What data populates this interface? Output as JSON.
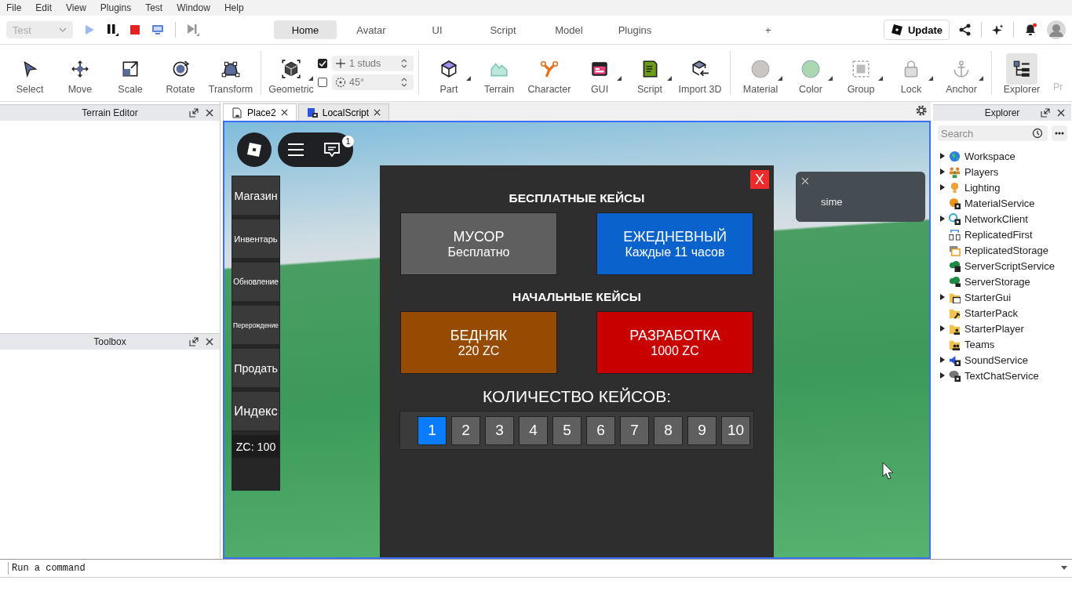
{
  "menu_bar": [
    "File",
    "Edit",
    "View",
    "Plugins",
    "Test",
    "Window",
    "Help"
  ],
  "mode_dropdown": {
    "value": "Test",
    "disabled": true
  },
  "ribbon_tabs": [
    {
      "label": "Home",
      "selected": true
    },
    {
      "label": "Avatar",
      "selected": false
    },
    {
      "label": "UI",
      "selected": false
    },
    {
      "label": "Script",
      "selected": false
    },
    {
      "label": "Model",
      "selected": false
    },
    {
      "label": "Plugins",
      "selected": false
    }
  ],
  "add_tab": "+",
  "update_button": "Update",
  "notification_dot": true,
  "tool_groups": [
    [
      {
        "label": "Select",
        "has_menu": false,
        "selected": false
      },
      {
        "label": "Move",
        "has_menu": false,
        "selected": false
      },
      {
        "label": "Scale",
        "has_menu": false,
        "selected": false
      },
      {
        "label": "Rotate",
        "has_menu": false,
        "selected": false
      },
      {
        "label": "Transform",
        "has_menu": false,
        "selected": false
      }
    ],
    [
      {
        "label": "Geometric",
        "has_menu": true,
        "selected": false
      }
    ],
    [
      {
        "label": "Part",
        "has_menu": true,
        "selected": false
      },
      {
        "label": "Terrain",
        "has_menu": false,
        "selected": false
      },
      {
        "label": "Character",
        "has_menu": false,
        "selected": false
      },
      {
        "label": "GUI",
        "has_menu": true,
        "selected": false
      },
      {
        "label": "Script",
        "has_menu": true,
        "selected": false
      },
      {
        "label": "Import 3D",
        "has_menu": false,
        "selected": false
      }
    ],
    [
      {
        "label": "Material",
        "has_menu": true,
        "selected": false
      },
      {
        "label": "Color",
        "has_menu": true,
        "selected": false
      },
      {
        "label": "Group",
        "has_menu": true,
        "selected": false
      },
      {
        "label": "Lock",
        "has_menu": true,
        "selected": false
      },
      {
        "label": "Anchor",
        "has_menu": true,
        "selected": false
      }
    ],
    [
      {
        "label": "Explorer",
        "has_menu": false,
        "selected": true
      }
    ]
  ],
  "cut_tool_label": "Pr",
  "snap": [
    {
      "checked": true,
      "value": "1 studs"
    },
    {
      "checked": false,
      "value": "45°"
    }
  ],
  "left_panels": [
    {
      "title": "Terrain Editor"
    },
    {
      "title": "Toolbox"
    }
  ],
  "document_tabs": [
    {
      "label": "Place2",
      "selected": true
    },
    {
      "label": "LocalScript",
      "selected": false
    }
  ],
  "game": {
    "chat_badge": "1",
    "side_menu": [
      "Магазин",
      "Инвентарь",
      "Обновление",
      "Перерождение",
      "Продать",
      "Индекс"
    ],
    "currency": "ZC: 100",
    "notification": {
      "text": "sime"
    },
    "panel": {
      "close": "X",
      "sections": [
        {
          "title": "БЕСПЛАТНЫЕ КЕЙСЫ",
          "cases": [
            {
              "title": "МУСОР",
              "subtitle": "Бесплатно",
              "color": "#5f5f5f"
            },
            {
              "title": "ЕЖЕДНЕВНЫЙ",
              "subtitle": "Каждые 11 часов",
              "color": "#0a63cc"
            }
          ]
        },
        {
          "title": "НАЧАЛЬНЫЕ КЕЙСЫ",
          "cases": [
            {
              "title": "БЕДНЯК",
              "subtitle": "220 ZC",
              "color": "#974b00"
            },
            {
              "title": "РАЗРАБОТКА",
              "subtitle": "1000 ZC",
              "color": "#c80000"
            }
          ]
        }
      ],
      "quantity_label": "КОЛИЧЕСТВО КЕЙСОВ:",
      "quantities": [
        {
          "label": "1",
          "selected": true
        },
        {
          "label": "2",
          "selected": false
        },
        {
          "label": "3",
          "selected": false
        },
        {
          "label": "4",
          "selected": false
        },
        {
          "label": "5",
          "selected": false
        },
        {
          "label": "6",
          "selected": false
        },
        {
          "label": "7",
          "selected": false
        },
        {
          "label": "8",
          "selected": false
        },
        {
          "label": "9",
          "selected": false
        },
        {
          "label": "10",
          "selected": false
        }
      ]
    }
  },
  "explorer": {
    "title": "Explorer",
    "search": {
      "placeholder": "Search"
    },
    "items": [
      {
        "label": "Workspace",
        "has_children": true
      },
      {
        "label": "Players",
        "has_children": true
      },
      {
        "label": "Lighting",
        "has_children": true
      },
      {
        "label": "MaterialService",
        "has_children": false
      },
      {
        "label": "NetworkClient",
        "has_children": true
      },
      {
        "label": "ReplicatedFirst",
        "has_children": false
      },
      {
        "label": "ReplicatedStorage",
        "has_children": false
      },
      {
        "label": "ServerScriptService",
        "has_children": false
      },
      {
        "label": "ServerStorage",
        "has_children": false
      },
      {
        "label": "StarterGui",
        "has_children": true
      },
      {
        "label": "StarterPack",
        "has_children": false
      },
      {
        "label": "StarterPlayer",
        "has_children": true
      },
      {
        "label": "Teams",
        "has_children": false
      },
      {
        "label": "SoundService",
        "has_children": true
      },
      {
        "label": "TextChatService",
        "has_children": true
      }
    ]
  },
  "command_bar": {
    "placeholder": "Run a command"
  }
}
